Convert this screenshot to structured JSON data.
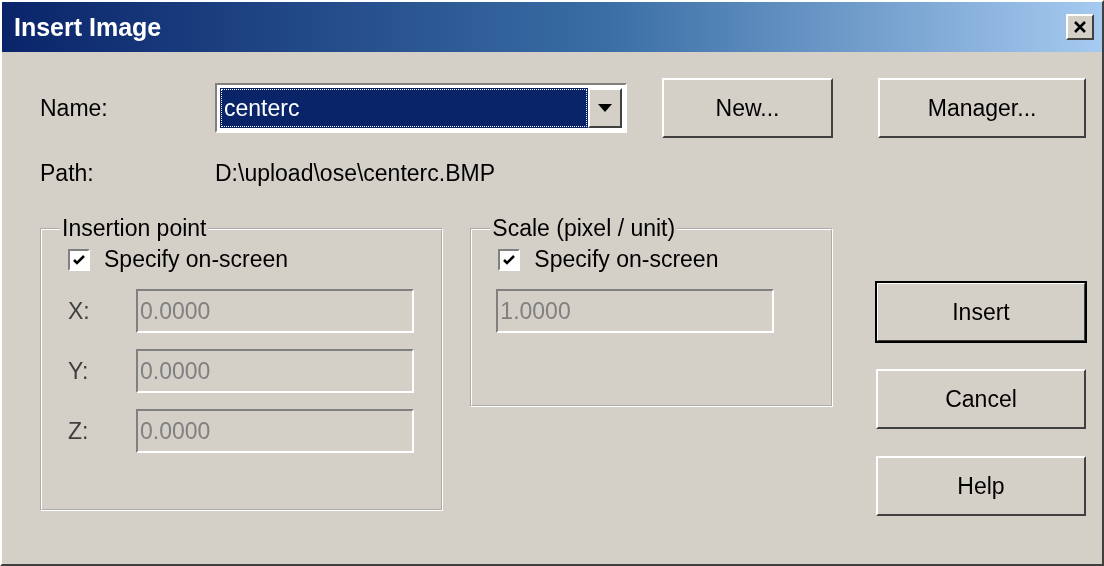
{
  "window": {
    "title": "Insert Image"
  },
  "name": {
    "label": "Name:",
    "value": "centerc"
  },
  "top_buttons": [
    {
      "label": "New..."
    },
    {
      "label": "Manager..."
    }
  ],
  "path": {
    "label": "Path:",
    "value": "D:\\upload\\ose\\centerc.BMP"
  },
  "insertion_point": {
    "title": "Insertion point",
    "specify": {
      "label": "Specify on-screen",
      "checked": true
    },
    "fields": [
      {
        "label": "X:",
        "value": "0.0000",
        "disabled": true
      },
      {
        "label": "Y:",
        "value": "0.0000",
        "disabled": true
      },
      {
        "label": "Z:",
        "value": "0.0000",
        "disabled": true
      }
    ]
  },
  "scale": {
    "title": "Scale (pixel / unit)",
    "specify": {
      "label": "Specify on-screen",
      "checked": true
    },
    "field": {
      "value": "1.0000",
      "disabled": true
    }
  },
  "actions": [
    {
      "label": "Insert",
      "default": true
    },
    {
      "label": "Cancel",
      "default": false
    },
    {
      "label": "Help",
      "default": false
    }
  ]
}
